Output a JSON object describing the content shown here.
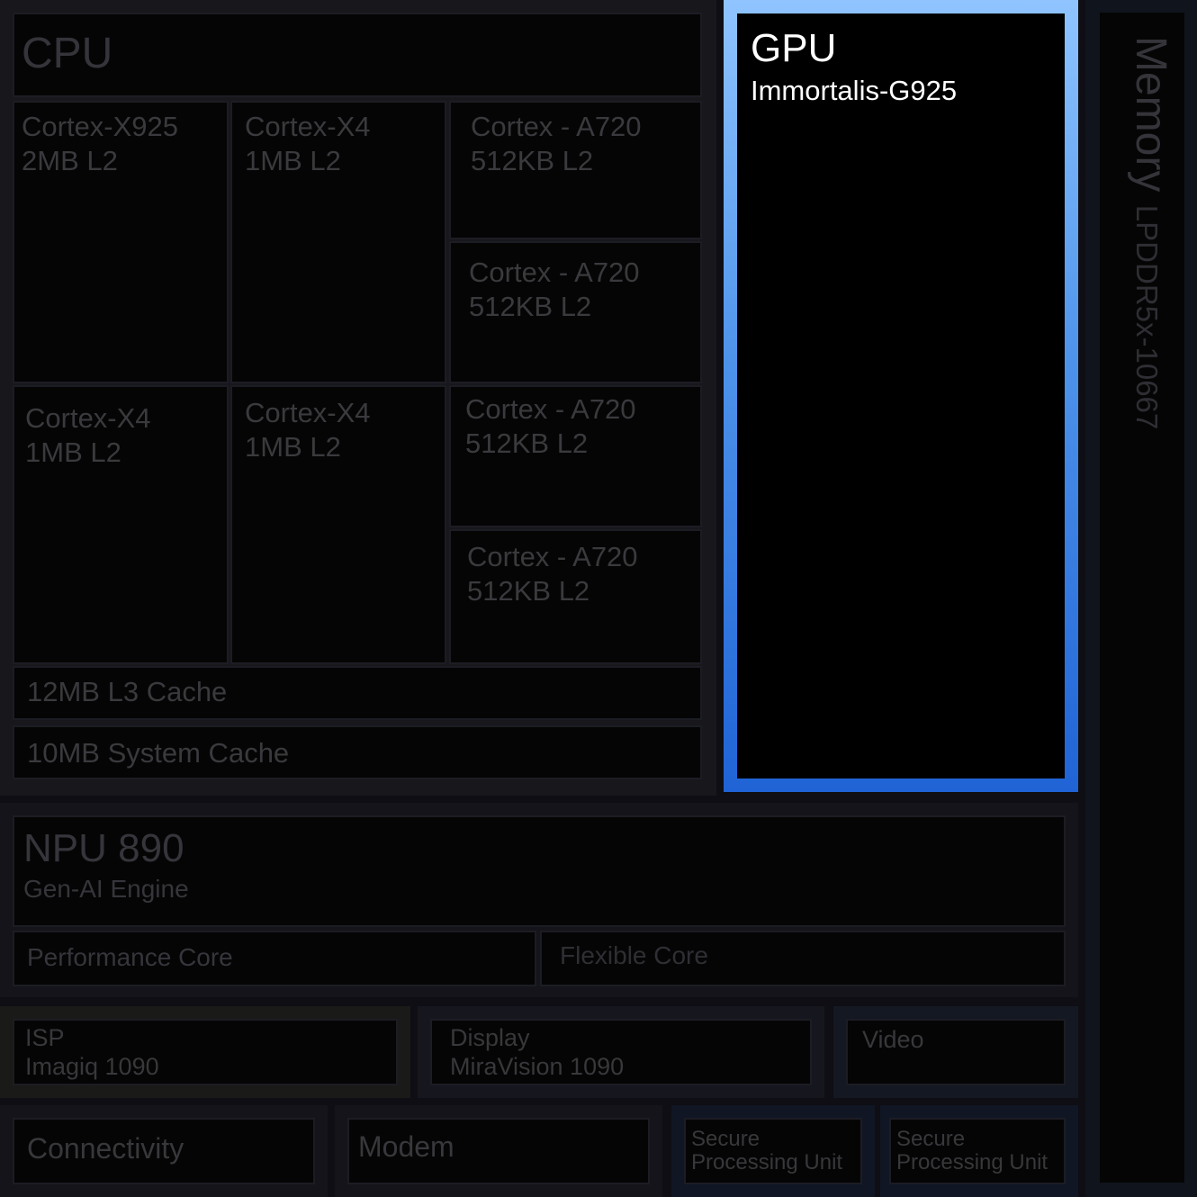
{
  "cpu": {
    "title": "CPU",
    "cores": [
      {
        "name": "Cortex-X925",
        "cache": "2MB L2"
      },
      {
        "name": "Cortex-X4",
        "cache": "1MB L2"
      },
      {
        "name": "Cortex - A720",
        "cache": "512KB L2"
      },
      {
        "name": "Cortex - A720",
        "cache": "512KB L2"
      },
      {
        "name": "Cortex-X4",
        "cache": "1MB L2"
      },
      {
        "name": "Cortex-X4",
        "cache": "1MB L2"
      },
      {
        "name": "Cortex - A720",
        "cache": "512KB L2"
      },
      {
        "name": "Cortex - A720",
        "cache": "512KB L2"
      }
    ],
    "l3": "12MB L3 Cache",
    "system_cache": "10MB System Cache"
  },
  "gpu": {
    "title": "GPU",
    "subtitle": "Immortalis-G925",
    "accent_top": "#8fc4ff",
    "accent_bottom": "#1f63d6"
  },
  "memory": {
    "title": "Memory",
    "subtitle": "LPDDR5x-10667"
  },
  "npu": {
    "title": "NPU 890",
    "subtitle": "Gen-AI Engine",
    "performance": "Performance Core",
    "flexible": "Flexible Core"
  },
  "isp": {
    "title": "ISP",
    "subtitle": "Imagiq 1090"
  },
  "display": {
    "title": "Display",
    "subtitle": "MiraVision 1090"
  },
  "video": {
    "title": "Video"
  },
  "connectivity": {
    "title": "Connectivity"
  },
  "modem": {
    "title": "Modem"
  },
  "secure": [
    {
      "line1": "Secure",
      "line2": "Processing Unit"
    },
    {
      "line1": "Secure",
      "line2": "Processing Unit"
    }
  ]
}
